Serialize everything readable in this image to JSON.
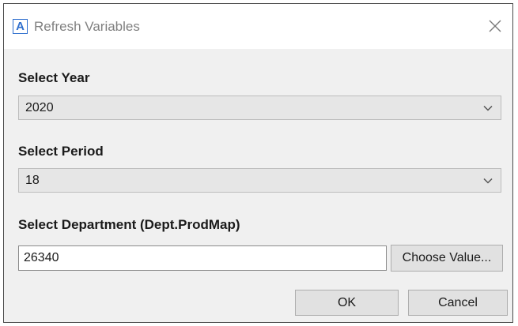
{
  "window": {
    "app_icon": "A",
    "title": "Refresh Variables",
    "close_icon": "close-icon"
  },
  "form": {
    "year": {
      "label": "Select Year",
      "selected": "2020"
    },
    "period": {
      "label": "Select Period",
      "selected": "18"
    },
    "department": {
      "label": "Select Department (Dept.ProdMap)",
      "value": "26340",
      "choose_label": "Choose Value..."
    }
  },
  "buttons": {
    "ok": "OK",
    "cancel": "Cancel"
  },
  "colors": {
    "accent": "#2f6fce",
    "dialog_bg": "#f0f0f0",
    "combo_bg": "#e6e6e6",
    "button_bg": "#e1e1e1"
  }
}
